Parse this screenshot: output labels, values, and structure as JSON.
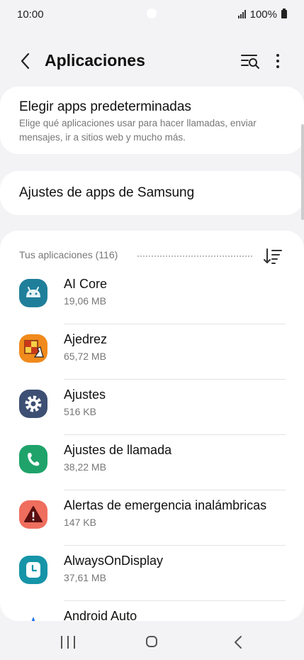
{
  "status": {
    "time": "10:00",
    "battery": "100%"
  },
  "header": {
    "title": "Aplicaciones",
    "back_icon": "chevron-left-icon",
    "search_icon": "list-search-icon",
    "more_icon": "more-vert-icon"
  },
  "default_apps": {
    "title": "Elegir apps predeterminadas",
    "description": "Elige qué aplicaciones usar para hacer llamadas, enviar mensajes, ir a sitios web y mucho más."
  },
  "samsung_settings": {
    "title": "Ajustes de apps de Samsung"
  },
  "apps_section": {
    "count_label": "Tus aplicaciones (116)",
    "sort_icon": "sort-icon",
    "items": [
      {
        "name": "AI Core",
        "size": "19,06 MB",
        "icon": "android-icon",
        "color": "#1f7f9a"
      },
      {
        "name": "Ajedrez",
        "size": "65,72 MB",
        "icon": "chess-icon",
        "color": "#f08a1c"
      },
      {
        "name": "Ajustes",
        "size": "516 KB",
        "icon": "gear-icon",
        "color": "#3d4f73"
      },
      {
        "name": "Ajustes de llamada",
        "size": "38,22 MB",
        "icon": "phone-icon",
        "color": "#1fa36a"
      },
      {
        "name": "Alertas de emergencia inalámbricas",
        "size": "147 KB",
        "icon": "warning-icon",
        "color": "#ef6e5e"
      },
      {
        "name": "AlwaysOnDisplay",
        "size": "37,61 MB",
        "icon": "clock-icon",
        "color": "#1694a8"
      },
      {
        "name": "Android Auto",
        "size": "",
        "icon": "android-auto-icon",
        "color": "#1a73e8"
      }
    ]
  },
  "nav": {
    "recent_icon": "recent-apps-icon",
    "home_icon": "home-icon",
    "back_icon": "back-icon"
  }
}
